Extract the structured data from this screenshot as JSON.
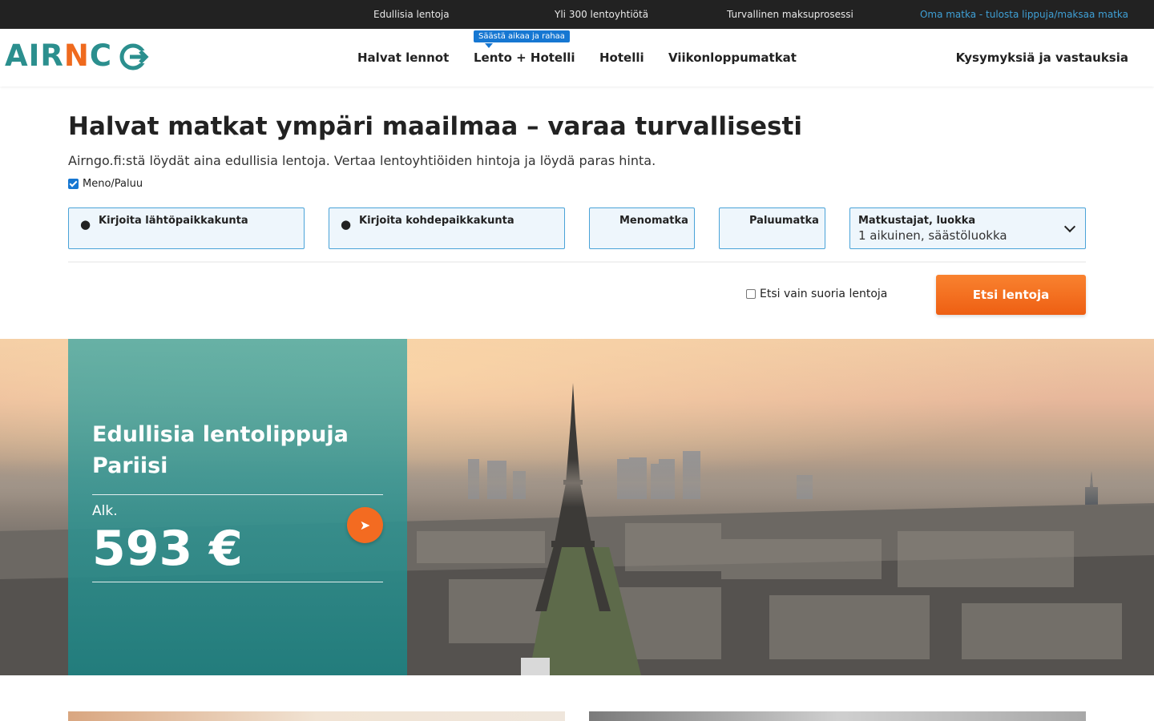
{
  "topbar": {
    "usps": [
      "Edullisia lentoja",
      "Yli 300 lentoyhtiötä",
      "Turvallinen maksuprosessi"
    ],
    "my_trip_link": "Oma matka - tulosta lippuja/maksaa matka"
  },
  "header": {
    "logo_text_part1": "AIR",
    "logo_text_part2": "N",
    "logo_text_part3": "C",
    "nav": [
      {
        "label": "Halvat lennot"
      },
      {
        "label": "Lento + Hotelli",
        "badge": "Säästä aikaa ja rahaa"
      },
      {
        "label": "Hotelli"
      },
      {
        "label": "Viikonloppumatkat"
      }
    ],
    "faq": "Kysymyksiä ja vastauksia"
  },
  "search": {
    "title": "Halvat matkat ympäri maailmaa – varaa turvallisesti",
    "subtitle": "Airngo.fi:stä löydät aina edullisia lentoja. Vertaa lentoyhtiöiden hintoja ja löydä paras hinta.",
    "roundtrip_label": "Meno/Paluu",
    "roundtrip_checked": true,
    "origin_label": "Kirjoita lähtöpaikkakunta",
    "destination_label": "Kirjoita kohdepaikkakunta",
    "depart_label": "Menomatka",
    "return_label": "Paluumatka",
    "travelers_label": "Matkustajat, luokka",
    "travelers_value": "1 aikuinen, säästöluokka",
    "direct_only_label": "Etsi vain suoria lentoja",
    "direct_only_checked": false,
    "search_button": "Etsi lentoja"
  },
  "hero": {
    "title": "Edullisia lentolippuja Pariisi",
    "from_label": "Alk.",
    "price": "593 €"
  },
  "icons": {
    "location": "map-marker-icon",
    "arrow": "arrow-right-icon",
    "chevron": "chevron-down-icon"
  },
  "colors": {
    "brand_teal": "#2b8f8e",
    "brand_orange": "#ef6a1e",
    "accent_blue": "#1677d2",
    "top_bar": "#222222"
  }
}
